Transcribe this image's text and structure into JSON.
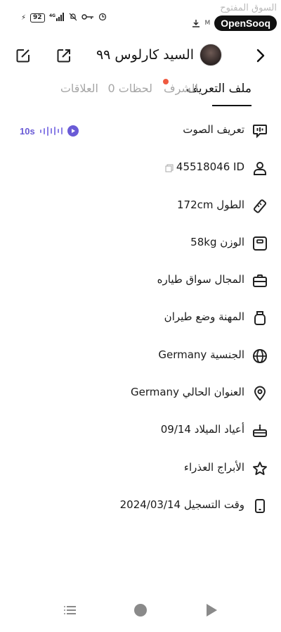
{
  "status_bar": {
    "battery": "92",
    "network": "4G",
    "watermark": "السوق المفتوح",
    "m_label": "M",
    "brand": "OpenSooq"
  },
  "header": {
    "username": "السيد كارلوس ٩٩",
    "back_icon": "chevron-right-icon",
    "share_icon": "share-icon",
    "edit_icon": "edit-icon"
  },
  "tabs": [
    {
      "label": "ملف التعريف",
      "active": true
    },
    {
      "label": "الشرف",
      "active": false,
      "dot": true
    },
    {
      "label": "لحظات 0",
      "active": false
    },
    {
      "label": "العلاقات",
      "active": false
    }
  ],
  "profile_rows": [
    {
      "id": "voice",
      "icon": "voice-intro-icon",
      "label": "تعريف الصوت",
      "audio_duration": "10s"
    },
    {
      "id": "id",
      "icon": "person-icon",
      "label": "45518046 ID"
    },
    {
      "id": "height",
      "icon": "ruler-icon",
      "label": "الطول",
      "value": "172cm"
    },
    {
      "id": "weight",
      "icon": "scale-icon",
      "label": "الوزن",
      "value": "58kg"
    },
    {
      "id": "field",
      "icon": "briefcase-icon",
      "label": "المجال سواق طياره"
    },
    {
      "id": "profession",
      "icon": "profession-icon",
      "label": "المهنة وضع طيران"
    },
    {
      "id": "nationality",
      "icon": "globe-icon",
      "label": "الجنسية",
      "value": "Germany"
    },
    {
      "id": "address",
      "icon": "location-pin-icon",
      "label": "العنوان الحالي",
      "value": "Germany"
    },
    {
      "id": "birthday",
      "icon": "cake-icon",
      "label": "أعياد الميلاد",
      "value": "09/14"
    },
    {
      "id": "zodiac",
      "icon": "star-icon",
      "label": "الأبراج العذراء"
    },
    {
      "id": "registration",
      "icon": "phone-icon",
      "label": "وقت التسجيل",
      "value": "2024/03/14"
    }
  ],
  "colors": {
    "accent": "#6a5bd6",
    "tab_dot": "#ef5a40",
    "inactive_tab": "#a6a6a6"
  },
  "nav_bar": {
    "menu_icon": "menu-icon",
    "home_icon": "home-circle-icon",
    "back_icon": "back-triangle-icon"
  }
}
